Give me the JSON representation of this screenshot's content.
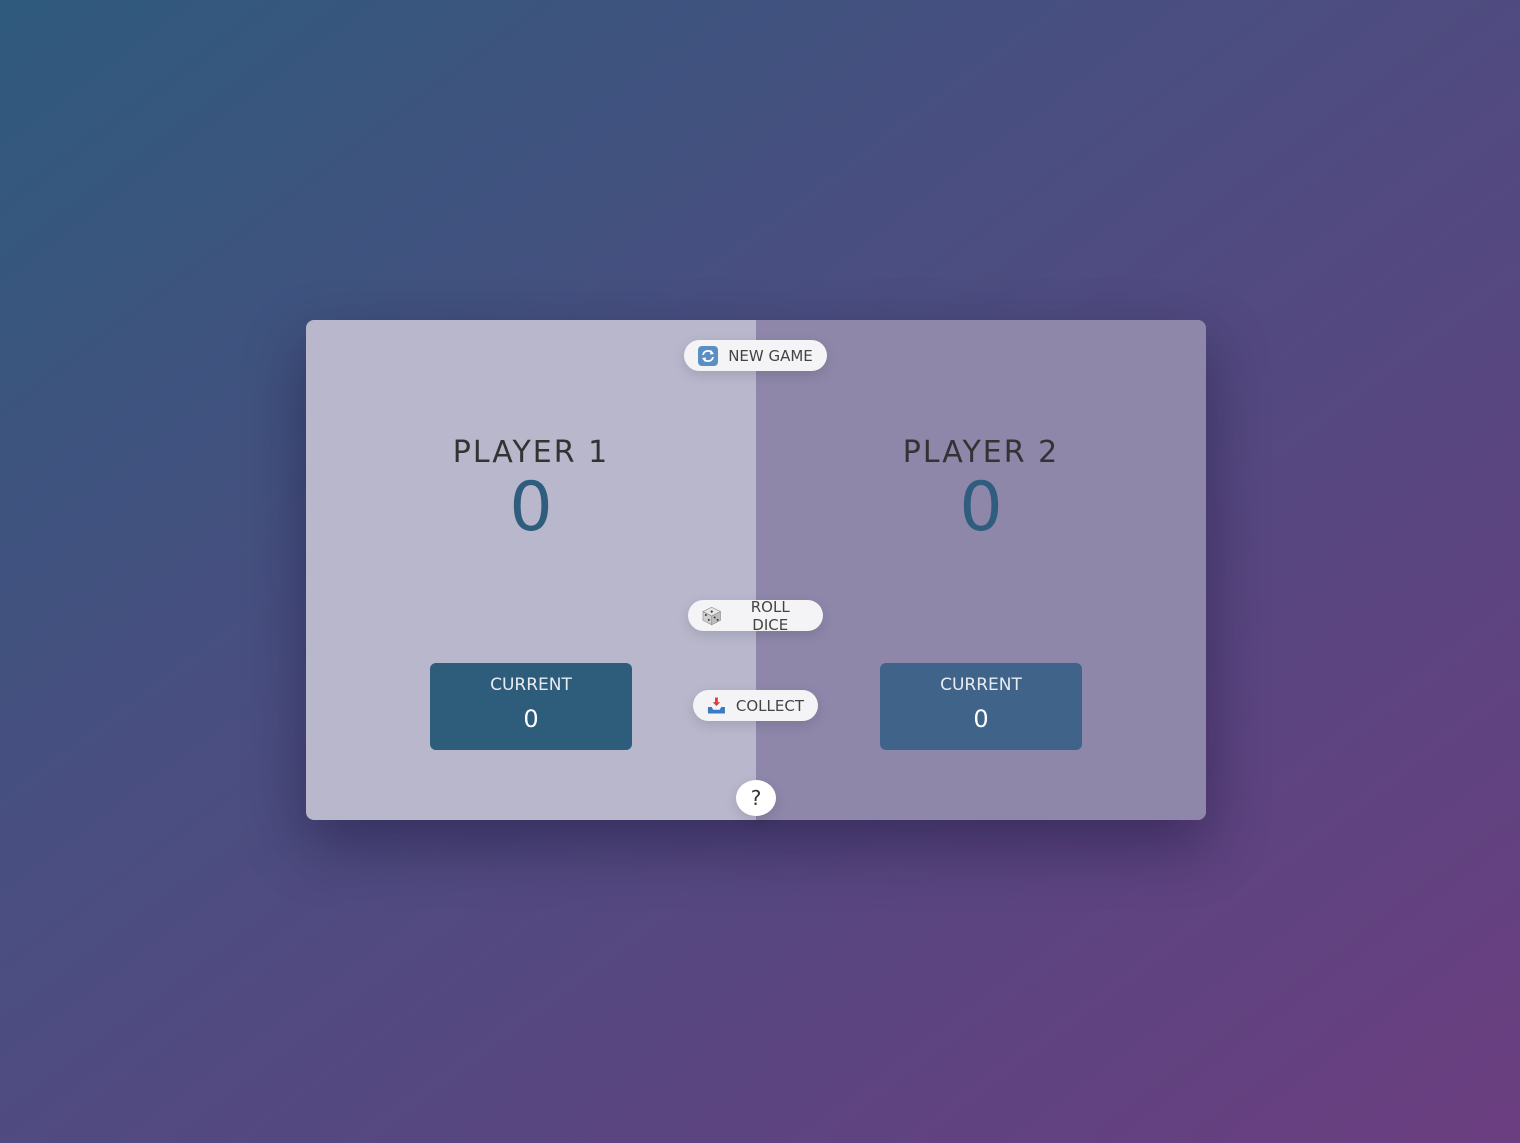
{
  "players": [
    {
      "name": "PLAYER 1",
      "score": "0",
      "current_label": "CURRENT",
      "current_score": "0"
    },
    {
      "name": "PLAYER 2",
      "score": "0",
      "current_label": "CURRENT",
      "current_score": "0"
    }
  ],
  "controls": {
    "new_game_label": "NEW GAME",
    "new_game_icon": "refresh-icon",
    "roll_dice_label": "ROLL DICE",
    "roll_dice_icon": "dice-icon",
    "collect_label": "COLLECT",
    "collect_icon": "inbox-tray-icon",
    "help_label": "?"
  },
  "colors": {
    "player_1_panel": "#b8b7cc",
    "player_2_panel": "#8e87aa",
    "score": "#2f5d7e",
    "current_box_1": "#2e5c7b",
    "current_box_2": "#406489"
  }
}
